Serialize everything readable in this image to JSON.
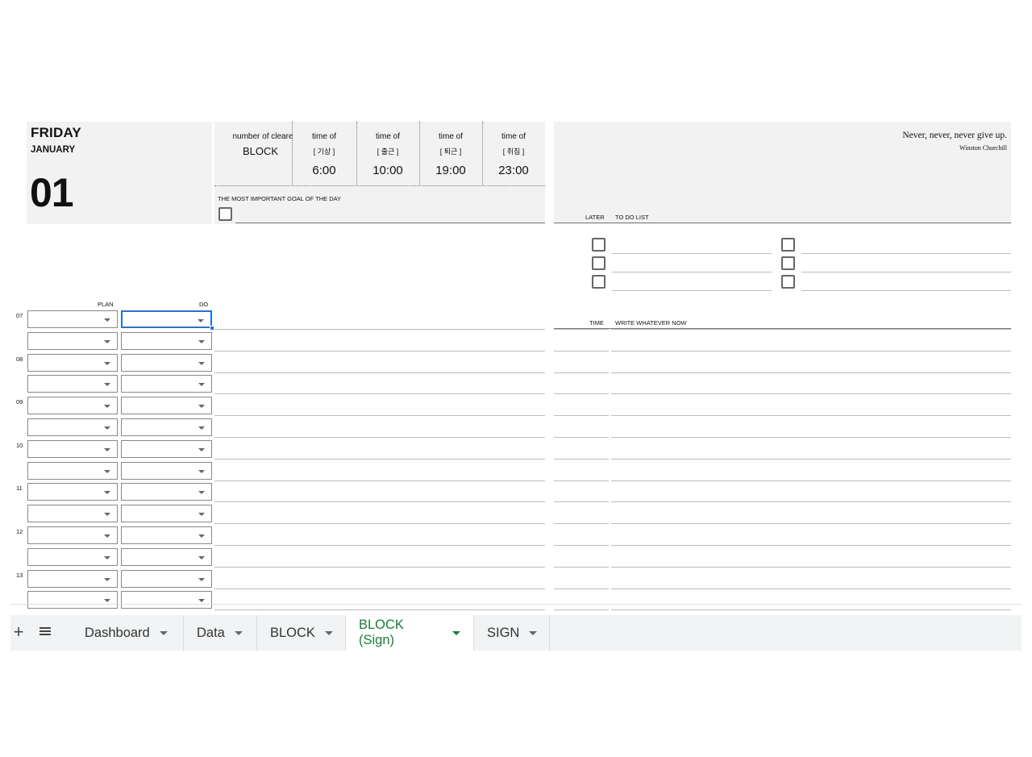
{
  "date": {
    "day_name": "FRIDAY",
    "month": "JANUARY",
    "day_number": "01"
  },
  "times": {
    "blocks_label": "number of cleare",
    "blocks_word": "BLOCK",
    "columns": [
      {
        "label": "time of",
        "bracket": "[    기상    ]",
        "value": "6:00"
      },
      {
        "label": "time of",
        "bracket": "[    출근    ]",
        "value": "10:00"
      },
      {
        "label": "time of",
        "bracket": "[    퇴근    ]",
        "value": "19:00"
      },
      {
        "label": "time of",
        "bracket": "[    취침    ]",
        "value": "23:00"
      }
    ]
  },
  "goal": {
    "label": "THE MOST IMPORTANT GOAL OF THE DAY",
    "checked": false
  },
  "quote": {
    "text": "Never, never, never give up.",
    "author": "Winston Churchill"
  },
  "todo": {
    "later_label": "LATER",
    "list_label": "TO DO LIST",
    "item_count_per_column": 3
  },
  "schedule": {
    "plan_label": "PLAN",
    "do_label": "DO",
    "time_label": "TIME",
    "write_label": "WRITE WHATEVER NOW",
    "hours": [
      "07",
      "08",
      "09",
      "10",
      "11",
      "12",
      "13"
    ],
    "rows_per_hour": 2,
    "selected_row": 0
  },
  "sheet_tabs": {
    "add_icon": "plus-icon",
    "menu_icon": "list-icon",
    "tabs": [
      {
        "label": "Dashboard",
        "active": false
      },
      {
        "label": "Data",
        "active": false
      },
      {
        "label": "BLOCK",
        "active": false
      },
      {
        "label": "BLOCK (Sign)",
        "active": true
      },
      {
        "label": "SIGN",
        "active": false
      }
    ],
    "active_color": "#188038"
  },
  "colors": {
    "panel_bg": "#f2f2f2",
    "selection": "#1a73e8"
  }
}
